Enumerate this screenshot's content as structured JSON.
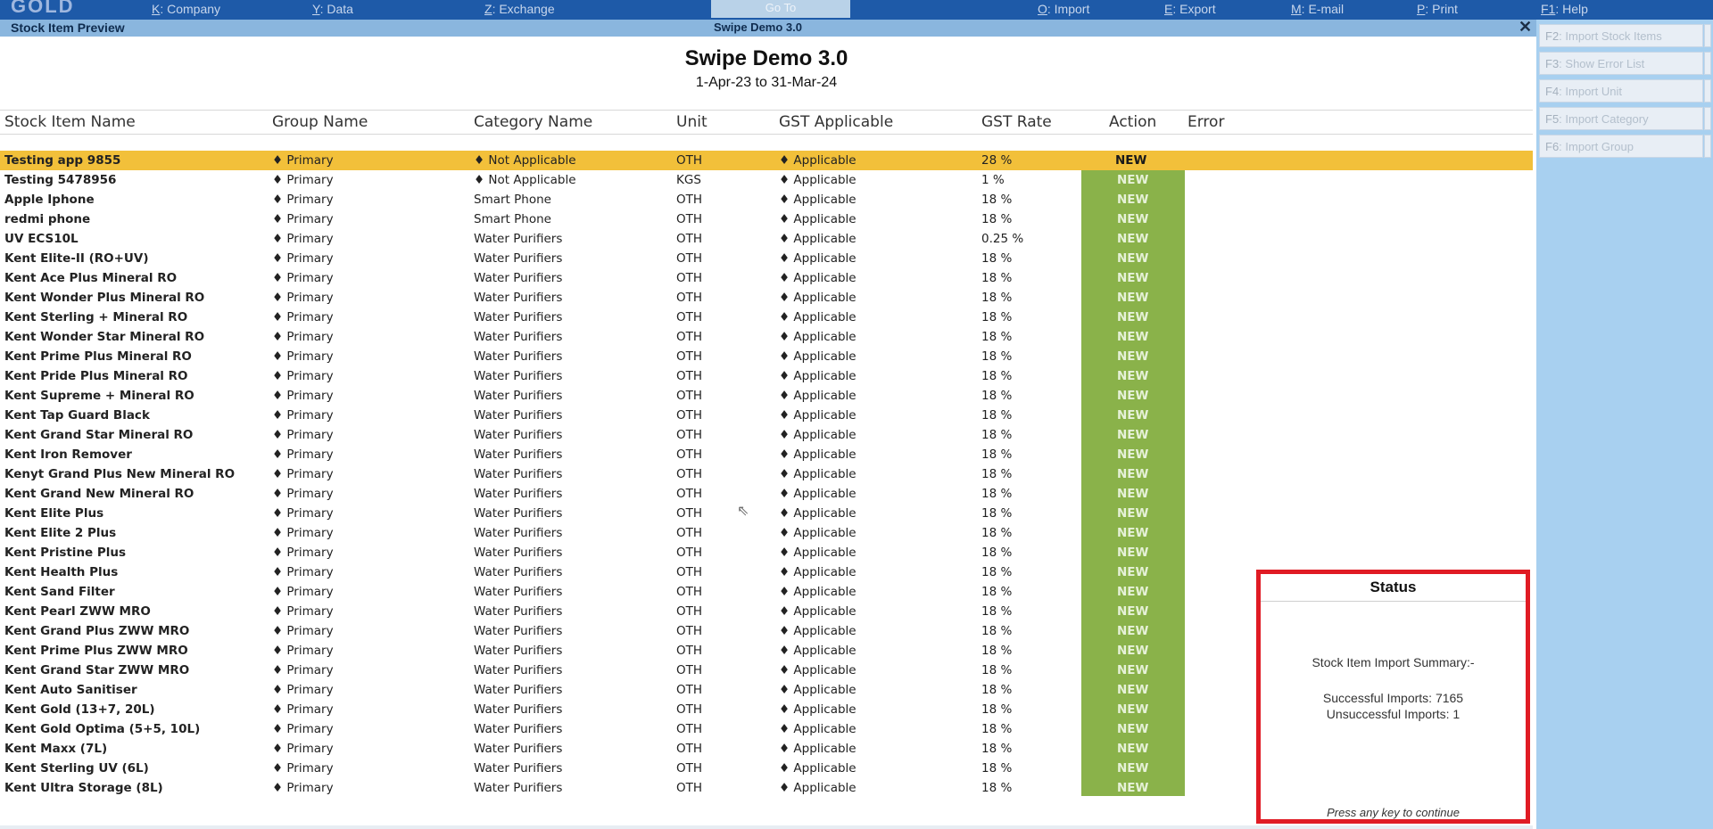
{
  "topbar": {
    "logo": "GOLD",
    "menus": [
      {
        "key": "K",
        "label": ": Company"
      },
      {
        "key": "Y",
        "label": ": Data"
      },
      {
        "key": "Z",
        "label": ": Exchange"
      },
      {
        "key": "O",
        "label": ": Import"
      },
      {
        "key": "E",
        "label": ": Export"
      },
      {
        "key": "M",
        "label": ": E-mail"
      },
      {
        "key": "P",
        "label": ": Print"
      },
      {
        "key": "F1",
        "label": ": Help"
      }
    ],
    "active_tab": "Go To"
  },
  "titlebar": {
    "left": "Stock Item Preview",
    "center": "Swipe Demo 3.0",
    "close": "✕"
  },
  "right_panel": [
    {
      "key": "F2",
      "label": ": Import Stock Items"
    },
    {
      "key": "F3",
      "label": ": Show Error List"
    },
    {
      "key": "F4",
      "label": ": Import Unit"
    },
    {
      "key": "F5",
      "label": ": Import Category"
    },
    {
      "key": "F6",
      "label": ": Import Group"
    }
  ],
  "report": {
    "company": "Swipe Demo 3.0",
    "period": "1-Apr-23 to 31-Mar-24",
    "columns": [
      "Stock Item Name",
      "Group Name",
      "Category Name",
      "Unit",
      "GST Applicable",
      "GST Rate",
      "Action",
      "Error"
    ],
    "rows": [
      [
        "Testing app 9855",
        "♦ Primary",
        "♦ Not Applicable",
        "OTH",
        "♦ Applicable",
        "28 %",
        "NEW"
      ],
      [
        "Testing 5478956",
        "♦ Primary",
        "♦ Not Applicable",
        "KGS",
        "♦ Applicable",
        "1 %",
        "NEW"
      ],
      [
        "Apple Iphone",
        "♦ Primary",
        "Smart Phone",
        "OTH",
        "♦ Applicable",
        "18 %",
        "NEW"
      ],
      [
        "redmi phone",
        "♦ Primary",
        "Smart Phone",
        "OTH",
        "♦ Applicable",
        "18 %",
        "NEW"
      ],
      [
        "UV ECS10L",
        "♦ Primary",
        "Water Purifiers",
        "OTH",
        "♦ Applicable",
        "0.25 %",
        "NEW"
      ],
      [
        "Kent Elite-II (RO+UV)",
        "♦ Primary",
        "Water Purifiers",
        "OTH",
        "♦ Applicable",
        "18 %",
        "NEW"
      ],
      [
        "Kent Ace Plus Mineral RO",
        "♦ Primary",
        "Water Purifiers",
        "OTH",
        "♦ Applicable",
        "18 %",
        "NEW"
      ],
      [
        "Kent Wonder Plus Mineral RO",
        "♦ Primary",
        "Water Purifiers",
        "OTH",
        "♦ Applicable",
        "18 %",
        "NEW"
      ],
      [
        "Kent Sterling + Mineral RO",
        "♦ Primary",
        "Water Purifiers",
        "OTH",
        "♦ Applicable",
        "18 %",
        "NEW"
      ],
      [
        "Kent Wonder Star Mineral RO",
        "♦ Primary",
        "Water Purifiers",
        "OTH",
        "♦ Applicable",
        "18 %",
        "NEW"
      ],
      [
        "Kent Prime Plus Mineral RO",
        "♦ Primary",
        "Water Purifiers",
        "OTH",
        "♦ Applicable",
        "18 %",
        "NEW"
      ],
      [
        "Kent Pride Plus Mineral RO",
        "♦ Primary",
        "Water Purifiers",
        "OTH",
        "♦ Applicable",
        "18 %",
        "NEW"
      ],
      [
        "Kent Supreme + Mineral RO",
        "♦ Primary",
        "Water Purifiers",
        "OTH",
        "♦ Applicable",
        "18 %",
        "NEW"
      ],
      [
        "Kent Tap Guard Black",
        "♦ Primary",
        "Water Purifiers",
        "OTH",
        "♦ Applicable",
        "18 %",
        "NEW"
      ],
      [
        "Kent Grand Star Mineral RO",
        "♦ Primary",
        "Water Purifiers",
        "OTH",
        "♦ Applicable",
        "18 %",
        "NEW"
      ],
      [
        "Kent Iron Remover",
        "♦ Primary",
        "Water Purifiers",
        "OTH",
        "♦ Applicable",
        "18 %",
        "NEW"
      ],
      [
        "Kenyt Grand Plus New Mineral RO",
        "♦ Primary",
        "Water Purifiers",
        "OTH",
        "♦ Applicable",
        "18 %",
        "NEW"
      ],
      [
        "Kent Grand New Mineral RO",
        "♦ Primary",
        "Water Purifiers",
        "OTH",
        "♦ Applicable",
        "18 %",
        "NEW"
      ],
      [
        "Kent Elite Plus",
        "♦ Primary",
        "Water Purifiers",
        "OTH",
        "♦ Applicable",
        "18 %",
        "NEW"
      ],
      [
        "Kent Elite 2 Plus",
        "♦ Primary",
        "Water Purifiers",
        "OTH",
        "♦ Applicable",
        "18 %",
        "NEW"
      ],
      [
        "Kent Pristine Plus",
        "♦ Primary",
        "Water Purifiers",
        "OTH",
        "♦ Applicable",
        "18 %",
        "NEW"
      ],
      [
        "Kent Health Plus",
        "♦ Primary",
        "Water Purifiers",
        "OTH",
        "♦ Applicable",
        "18 %",
        "NEW"
      ],
      [
        "Kent Sand Filter",
        "♦ Primary",
        "Water Purifiers",
        "OTH",
        "♦ Applicable",
        "18 %",
        "NEW"
      ],
      [
        "Kent Pearl ZWW MRO",
        "♦ Primary",
        "Water Purifiers",
        "OTH",
        "♦ Applicable",
        "18 %",
        "NEW"
      ],
      [
        "Kent Grand Plus ZWW MRO",
        "♦ Primary",
        "Water Purifiers",
        "OTH",
        "♦ Applicable",
        "18 %",
        "NEW"
      ],
      [
        "Kent Prime Plus ZWW MRO",
        "♦ Primary",
        "Water Purifiers",
        "OTH",
        "♦ Applicable",
        "18 %",
        "NEW"
      ],
      [
        "Kent Grand Star ZWW MRO",
        "♦ Primary",
        "Water Purifiers",
        "OTH",
        "♦ Applicable",
        "18 %",
        "NEW"
      ],
      [
        "Kent Auto Sanitiser",
        "♦ Primary",
        "Water Purifiers",
        "OTH",
        "♦ Applicable",
        "18 %",
        "NEW"
      ],
      [
        "Kent Gold (13+7, 20L)",
        "♦ Primary",
        "Water Purifiers",
        "OTH",
        "♦ Applicable",
        "18 %",
        "NEW"
      ],
      [
        "Kent Gold Optima (5+5, 10L)",
        "♦ Primary",
        "Water Purifiers",
        "OTH",
        "♦ Applicable",
        "18 %",
        "NEW"
      ],
      [
        "Kent Maxx (7L)",
        "♦ Primary",
        "Water Purifiers",
        "OTH",
        "♦ Applicable",
        "18 %",
        "NEW"
      ],
      [
        "Kent Sterling UV (6L)",
        "♦ Primary",
        "Water Purifiers",
        "OTH",
        "♦ Applicable",
        "18 %",
        "NEW"
      ],
      [
        "Kent Ultra Storage (8L)",
        "♦ Primary",
        "Water Purifiers",
        "OTH",
        "♦ Applicable",
        "18 %",
        "NEW"
      ]
    ]
  },
  "status": {
    "title": "Status",
    "summary": "Stock Item Import Summary:-",
    "successful": "Successful Imports: 7165",
    "unsuccessful": "Unsuccessful Imports: 1",
    "press": "Press any key to continue"
  },
  "colors": {
    "menu_bar": "#1e5aa8",
    "title_bar": "#8ab6de",
    "selected_row": "#f2c03a",
    "action_new": "#8ab24a",
    "status_border": "#e01b24",
    "right_panel": "#a8d0f0"
  }
}
